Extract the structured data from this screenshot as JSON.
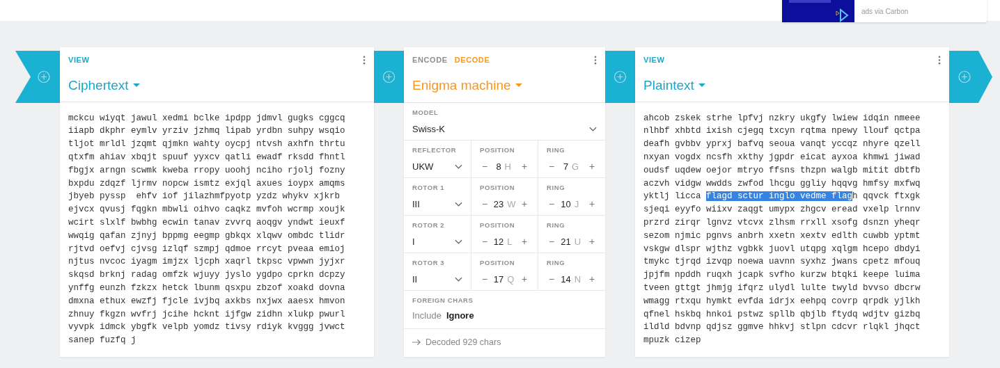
{
  "ad": {
    "kind": "picture",
    "caption": "ads via Carbon"
  },
  "panels": [
    {
      "kind": "text",
      "mode_tabs": [
        {
          "label": "VIEW",
          "selected": true
        }
      ],
      "title": "Ciphertext",
      "lines": [
        "mckcu wiyqt jawul xedmi bclke ipdpp jdmvl gugks cggcq",
        "iiapb dkphr eymlv yrziv jzhmq lipab yrdbn suhpy wsqio",
        "tljot mrldl jzqmt qjmkn wahty oycpj ntvsh axhfn thrtu",
        "qtxfm ahiav xbqjt spuuf yyxcv qatli ewadf rksdd fhntl",
        "fbgjx arngn scwmk kweba rropy uoohj nciho rjolj fozny",
        "bxpdu zdqzf ljrmv nopcw ismtz exjql axues ioypx amqms",
        "jbyeb pyssp  ehfv iof jilazhmfpyotp yzdz whykv xjkrb",
        "ejvcx qvusj fqgkn mbwli oihvo caqkz mvfoh wcrmp xoujk",
        "wcirt slxlf bwbhg ecwin tanav zvvrq aoqgv yndwt ieuxf",
        "wwqig qafan zjnyj bppmg eegmp gbkqx xlqwv ombdc tlidr",
        "rjtvd oefvj cjvsg izlqf szmpj qdmoe rrcyt pveaa emioj",
        "njtus nvcoc iyagm imjzx ljcph xaqrl tkpsc vpwwn jyjxr",
        "skqsd brknj radag omfzk wjuyy jyslo ygdpo cprkn dcpzy",
        "ynffg eunzh fzkzx hetck lbunm qsxpu zbzof xoakd dovna",
        "dmxna ethux ewzfj fjcle ivjbq axkbs nxjwx aaesx hmvon",
        "zhnuy fkgzn wvfrj jcihe hcknt ijfgw zidhn xlukp pwurl",
        "vyvpk idmck ybgfk velpb yomdz tivsy rdiyk kvggg jvwct",
        "sanep fuzfq j"
      ]
    },
    {
      "kind": "operation",
      "mode_tabs": [
        {
          "label": "ENCODE",
          "selected": false
        },
        {
          "label": "DECODE",
          "selected": true
        }
      ],
      "title": "Enigma machine",
      "model": {
        "label": "MODEL",
        "value": "Swiss-K"
      },
      "rows": [
        {
          "label": "REFLECTOR",
          "value": "UKW",
          "position": {
            "label": "POSITION",
            "minus": "−",
            "value": "8",
            "letter": "H",
            "plus": "+"
          },
          "ring": {
            "label": "RING",
            "minus": "−",
            "value": "7",
            "letter": "G",
            "plus": "+"
          }
        },
        {
          "label": "ROTOR 1",
          "value": "III",
          "position": {
            "label": "POSITION",
            "minus": "−",
            "value": "23",
            "letter": "W",
            "plus": "+"
          },
          "ring": {
            "label": "RING",
            "minus": "−",
            "value": "10",
            "letter": "J",
            "plus": "+"
          }
        },
        {
          "label": "ROTOR 2",
          "value": "I",
          "position": {
            "label": "POSITION",
            "minus": "−",
            "value": "12",
            "letter": "L",
            "plus": "+"
          },
          "ring": {
            "label": "RING",
            "minus": "−",
            "value": "21",
            "letter": "U",
            "plus": "+"
          }
        },
        {
          "label": "ROTOR 3",
          "value": "II",
          "position": {
            "label": "POSITION",
            "minus": "−",
            "value": "17",
            "letter": "Q",
            "plus": "+"
          },
          "ring": {
            "label": "RING",
            "minus": "−",
            "value": "14",
            "letter": "N",
            "plus": "+"
          }
        }
      ],
      "foreign": {
        "label": "FOREIGN CHARS",
        "options": [
          {
            "label": "Include",
            "selected": false
          },
          {
            "label": "Ignore",
            "selected": true
          }
        ]
      },
      "status": "Decoded 929 chars"
    },
    {
      "kind": "text",
      "mode_tabs": [
        {
          "label": "VIEW",
          "selected": true
        }
      ],
      "title": "Plaintext",
      "lines": [
        "ahcob zskek strhe lpfvj nzkry ukgfy lwiew idqin nmeee",
        "nlhbf xhbtd ixish cjegq txcyn rqtma npewy llouf qctpa",
        "deafh gvbbv yprxj bafvq seoua vanqt yccqz nhyre qzell",
        "nxyan vogdx ncsfh xkthy jgpdr eicat ayxoa khmwi jiwad",
        "oudsf uqdew oejor mtryo ffsns thzpn walgb mitit dbtfb",
        "aczvh vidgw wwdds zwfod lhcgu ggliy hqqvg hmfsy mxfwq",
        {
          "parts": [
            {
              "text": "yktlj licca ",
              "selected": false
            },
            {
              "text": "flagd sctur inglo vedme flag",
              "selected": true
            },
            {
              "text": "h qqvck ftxgk",
              "selected": false
            }
          ]
        },
        "sjeqi eyyfo wiixv zaqgt umypx zhgcv eread vxelp lrnnv",
        "przrd zirqr lgnvz vtcvx zlhsm rrxll xsofg dsnzn yheqr",
        "sezom njmic pgnvs anbrh xxetn xextv edlth cuwbb yptmt",
        "vskgw dlspr wjthz vgbkk juovl utqpg xqlgm hcepo dbdyi",
        "tmykc tjrqd izvqp noewa uavnn syxhz jwans cpetz mfouq",
        "jpjfm npddh ruqxh jcapk svfho kurzw btqki keepe luima",
        "tveen gttgt jhmjg ifqrz ulydl lulte twyld bvvso dbcrw",
        "wmagg rtxqu hymkt evfda idrjx eehpq covrp qrpdk yjlkh",
        "qfnel hskbq hnkoi pstwz spllb qbjlb ftydq wdjtv gizbq",
        "ildld bdvnp qdjsz ggmve hhkvj stlpn cdcvr rlqkl jhqct",
        "mpuzk cizep"
      ]
    }
  ]
}
